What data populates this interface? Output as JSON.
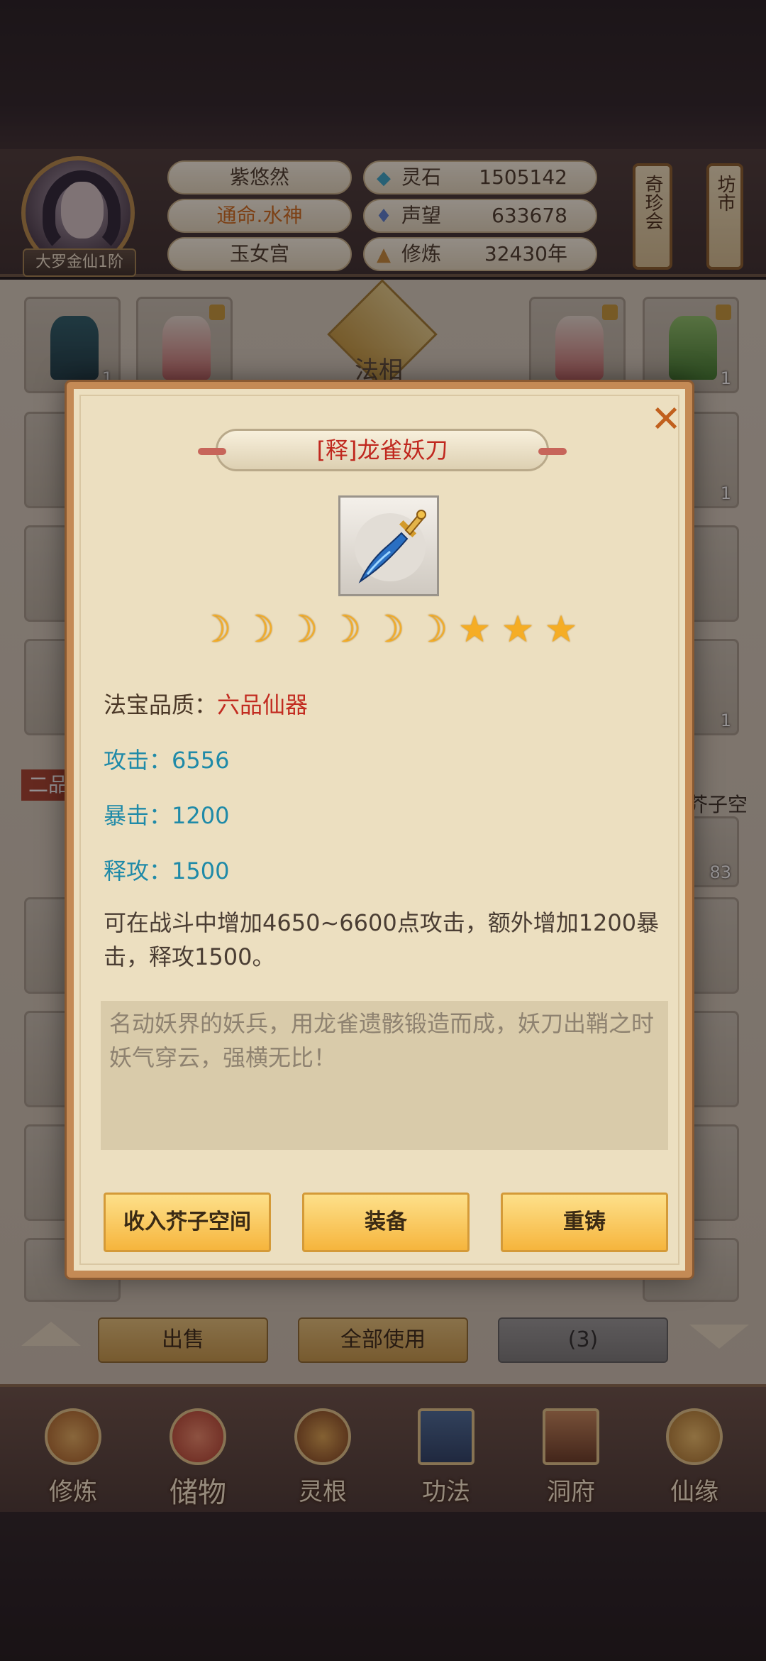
{
  "header": {
    "rank": "大罗金仙1阶",
    "name": "紫悠然",
    "title": "通命.水神",
    "sect": "玉女宫",
    "resources": [
      {
        "label": "灵石",
        "value": "1505142",
        "icon": "spirit-stone-icon"
      },
      {
        "label": "声望",
        "value": "633678",
        "icon": "reputation-icon"
      },
      {
        "label": "修炼",
        "value": "32430年",
        "icon": "cultivation-icon"
      }
    ],
    "side_buttons": [
      "奇珍会",
      "坊市"
    ]
  },
  "board": {
    "center_label": "法相",
    "tier_label": "二品",
    "space_label": "芥子空间",
    "counts": [
      "1",
      "1",
      "1",
      "1",
      "83"
    ]
  },
  "actions": {
    "sell": "出售",
    "use_all": "全部使用",
    "count": "(3)"
  },
  "nav": [
    {
      "label": "修炼",
      "icon": "cultivation-nav-icon"
    },
    {
      "label": "储物",
      "icon": "storage-bag-icon"
    },
    {
      "label": "灵根",
      "icon": "spirit-root-icon"
    },
    {
      "label": "功法",
      "icon": "technique-book-icon"
    },
    {
      "label": "洞府",
      "icon": "cave-residence-icon"
    },
    {
      "label": "仙缘",
      "icon": "immortal-fate-icon"
    }
  ],
  "modal": {
    "title": "[释]龙雀妖刀",
    "rating": {
      "moons": 6,
      "stars": 3
    },
    "quality_label": "法宝品质：",
    "quality_value": "六品仙器",
    "stats": [
      {
        "text": "攻击：6556"
      },
      {
        "text": "暴击：1200"
      },
      {
        "text": "释攻：1500"
      }
    ],
    "description": "可在战斗中增加4650~6600点攻击，额外增加1200暴击，释攻1500。",
    "lore": "名动妖界的妖兵，用龙雀遗骸锻造而成，妖刀出鞘之时妖气穿云，强横无比！",
    "buttons": {
      "store": "收入芥子空间",
      "equip": "装备",
      "reforge": "重铸"
    },
    "close_glyph": "✕"
  },
  "colors": {
    "title_red": "#c0281f",
    "stat_blue": "#1f8aa8",
    "quality_red": "#c22b20",
    "button_gold": "#f6b53d",
    "frame_brown": "#c48a55"
  }
}
